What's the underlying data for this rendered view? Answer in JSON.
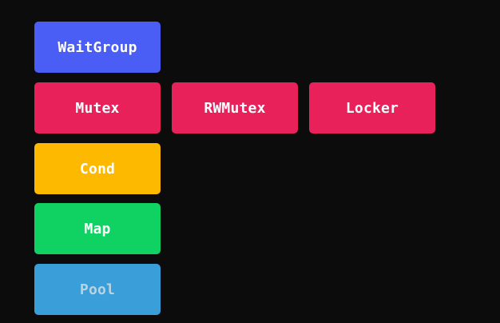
{
  "boxes": {
    "waitgroup": {
      "label": "WaitGroup",
      "color": "#4a5df5",
      "text_color": "#ffffff"
    },
    "mutex": {
      "label": "Mutex",
      "color": "#e8215b",
      "text_color": "#ffffff"
    },
    "rwmutex": {
      "label": "RWMutex",
      "color": "#e8215b",
      "text_color": "#ffffff"
    },
    "locker": {
      "label": "Locker",
      "color": "#e8215b",
      "text_color": "#ffffff"
    },
    "cond": {
      "label": "Cond",
      "color": "#fdb900",
      "text_color": "#ffffff"
    },
    "map": {
      "label": "Map",
      "color": "#10d262",
      "text_color": "#ffffff"
    },
    "pool": {
      "label": "Pool",
      "color": "#3a9ed8",
      "text_color": "#b9d3e2"
    }
  },
  "background": "#0c0c0c"
}
